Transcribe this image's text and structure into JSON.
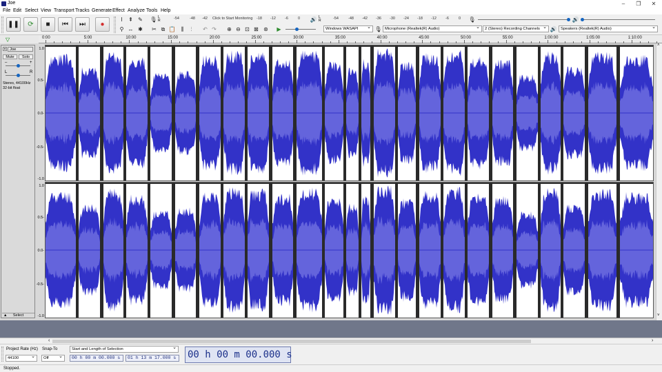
{
  "window": {
    "title": "Joe",
    "minimize": "–",
    "maximize": "❐",
    "close": "✕"
  },
  "menu": [
    "File",
    "Edit",
    "Select",
    "View",
    "Transport",
    "Tracks",
    "Generate",
    "Effect",
    "Analyze",
    "Tools",
    "Help"
  ],
  "meters": {
    "record_scale": [
      "-54",
      "-48",
      "-42",
      "-18",
      "-12",
      "-6",
      "0"
    ],
    "record_hint": "Click to Start Monitoring",
    "playback_scale": [
      "-54",
      "-48",
      "-42",
      "-36",
      "-30",
      "-24",
      "-18",
      "-12",
      "-6",
      "0"
    ],
    "lr_left": "L",
    "lr_right": "R"
  },
  "devices": {
    "host": "Windows WASAPI",
    "recording_device": "Microphone (Realtek(R) Audio)",
    "channels": "2 (Stereo) Recording Channels",
    "playback_device": "Speakers (Realtek(R) Audio)"
  },
  "ruler": {
    "labels": [
      "0:00",
      "5:00",
      "10:00",
      "15:00",
      "20:00",
      "25:00",
      "30:00",
      "35:00",
      "40:00",
      "45:00",
      "50:00",
      "55:00",
      "1:00:00",
      "1:05:00",
      "1:10:00"
    ]
  },
  "track": {
    "name": "Joe",
    "mute": "Mute",
    "solo": "Solo",
    "gain_minus": "–",
    "gain_plus": "+",
    "pan_left": "L",
    "pan_right": "R",
    "info_line1": "Stereo, 44100Hz",
    "info_line2": "32-bit float",
    "collapse": "▲",
    "select_label": "Select",
    "vscale": [
      "1.0",
      "0.5-",
      "0.0-",
      "-0.5-",
      "-1.0"
    ],
    "clips": [
      {
        "start": 0.0,
        "end": 0.05,
        "amp": 0.92
      },
      {
        "start": 0.055,
        "end": 0.09,
        "amp": 0.72
      },
      {
        "start": 0.095,
        "end": 0.128,
        "amp": 0.95
      },
      {
        "start": 0.133,
        "end": 0.168,
        "amp": 0.86
      },
      {
        "start": 0.173,
        "end": 0.208,
        "amp": 0.62
      },
      {
        "start": 0.213,
        "end": 0.248,
        "amp": 0.66
      },
      {
        "start": 0.253,
        "end": 0.288,
        "amp": 0.9
      },
      {
        "start": 0.293,
        "end": 0.328,
        "amp": 0.97
      },
      {
        "start": 0.333,
        "end": 0.368,
        "amp": 0.95
      },
      {
        "start": 0.373,
        "end": 0.408,
        "amp": 0.88
      },
      {
        "start": 0.413,
        "end": 0.455,
        "amp": 0.97
      },
      {
        "start": 0.46,
        "end": 0.49,
        "amp": 0.8
      },
      {
        "start": 0.495,
        "end": 0.515,
        "amp": 0.72
      },
      {
        "start": 0.52,
        "end": 0.535,
        "amp": 0.84
      },
      {
        "start": 0.54,
        "end": 0.575,
        "amp": 1.0
      },
      {
        "start": 0.58,
        "end": 0.61,
        "amp": 0.8
      },
      {
        "start": 0.615,
        "end": 0.65,
        "amp": 0.93
      },
      {
        "start": 0.655,
        "end": 0.69,
        "amp": 0.98
      },
      {
        "start": 0.695,
        "end": 0.73,
        "amp": 0.88
      },
      {
        "start": 0.735,
        "end": 0.77,
        "amp": 0.84
      },
      {
        "start": 0.775,
        "end": 0.81,
        "amp": 0.6
      },
      {
        "start": 0.815,
        "end": 0.848,
        "amp": 0.96
      },
      {
        "start": 0.853,
        "end": 0.888,
        "amp": 0.72
      },
      {
        "start": 0.893,
        "end": 0.94,
        "amp": 0.95
      },
      {
        "start": 0.945,
        "end": 1.0,
        "amp": 0.9
      }
    ]
  },
  "selection_toolbar": {
    "project_rate_label": "Project Rate (Hz)",
    "project_rate_value": "44100",
    "snap_label": "Snap-To",
    "snap_value": "Off",
    "selection_mode": "Start and Length of Selection",
    "sel_start": "00 h 00 m 00.000 s",
    "sel_length": "01 h 13 m 17.000 s",
    "audio_position": "00 h 00 m 00.000 s"
  },
  "status": "Stopped.",
  "colors": {
    "wave_fill": "#3232c8",
    "wave_rms": "#6464dc",
    "track_bg": "#ffffff"
  }
}
